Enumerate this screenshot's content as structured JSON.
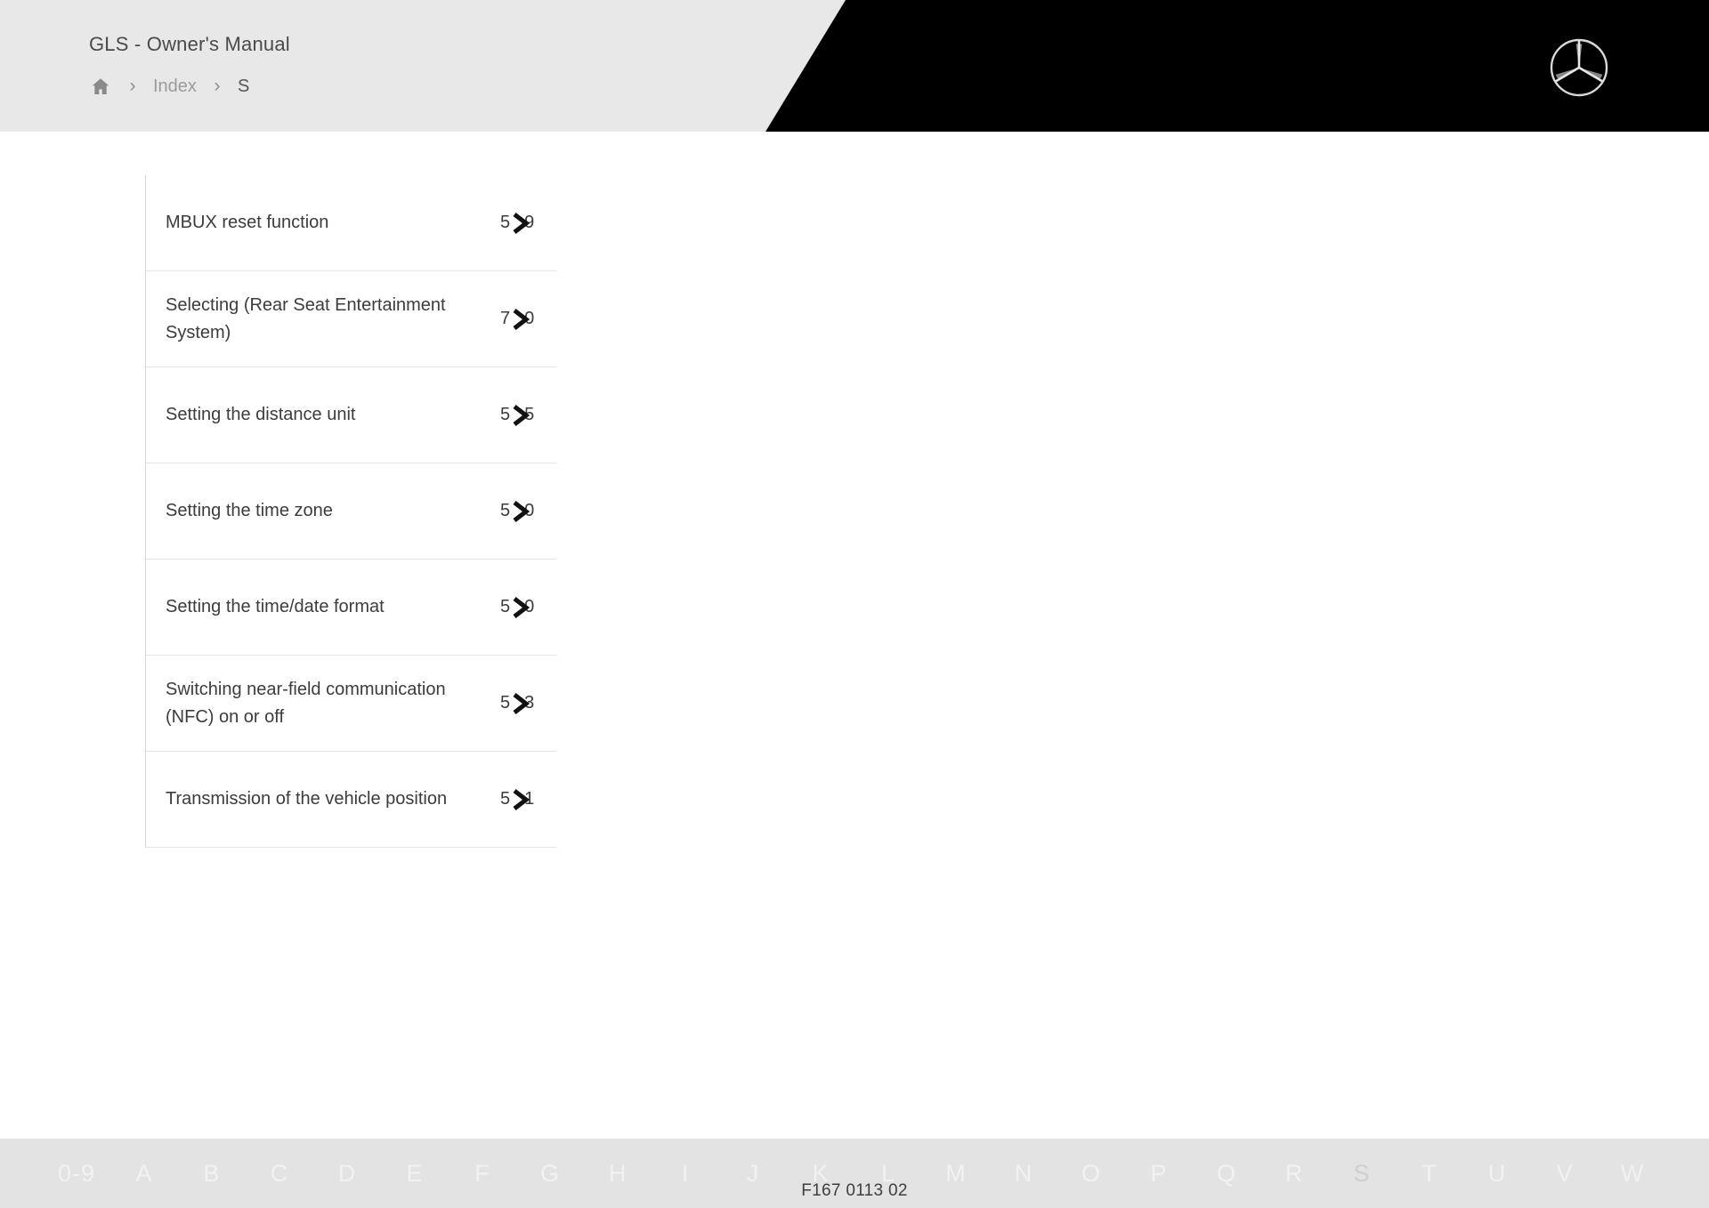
{
  "header": {
    "title": "GLS - Owner's Manual",
    "breadcrumb": {
      "home_icon": "home-icon",
      "separator": "›",
      "items": [
        {
          "label": "Index",
          "current": false
        },
        {
          "label": "S",
          "current": true
        }
      ]
    },
    "brand_logo": "mercedes-star-icon",
    "background_color": "#e8e8e8",
    "panel_color": "#000000"
  },
  "index_list": {
    "rows": [
      {
        "label": "MBUX reset function",
        "page": "59",
        "page_prefix": "5",
        "page_suffix": "9",
        "chevron": "chevron-right-icon"
      },
      {
        "label": "Selecting (Rear Seat Entertainment System)",
        "page": "70",
        "page_prefix": "7",
        "page_suffix": "0",
        "chevron": "chevron-right-icon"
      },
      {
        "label": "Setting the distance unit",
        "page": "55",
        "page_prefix": "5",
        "page_suffix": "5",
        "chevron": "chevron-right-icon"
      },
      {
        "label": "Setting the time zone",
        "page": "50",
        "page_prefix": "5",
        "page_suffix": "0",
        "chevron": "chevron-right-icon"
      },
      {
        "label": "Setting the time/date format",
        "page": "50",
        "page_prefix": "5",
        "page_suffix": "0",
        "chevron": "chevron-right-icon"
      },
      {
        "label": "Switching near-field communication (NFC) on or off",
        "page": "53",
        "page_prefix": "5",
        "page_suffix": "3",
        "chevron": "chevron-right-icon"
      },
      {
        "label": "Transmission of the vehicle position",
        "page": "51",
        "page_prefix": "5",
        "page_suffix": "1",
        "chevron": "chevron-right-icon"
      }
    ]
  },
  "footer": {
    "alphabet": [
      {
        "label": "0-9",
        "active": false
      },
      {
        "label": "A",
        "active": false
      },
      {
        "label": "B",
        "active": false
      },
      {
        "label": "C",
        "active": false
      },
      {
        "label": "D",
        "active": false
      },
      {
        "label": "E",
        "active": false
      },
      {
        "label": "F",
        "active": false
      },
      {
        "label": "G",
        "active": false
      },
      {
        "label": "H",
        "active": false
      },
      {
        "label": "I",
        "active": false
      },
      {
        "label": "J",
        "active": false
      },
      {
        "label": "K",
        "active": false
      },
      {
        "label": "L",
        "active": false
      },
      {
        "label": "M",
        "active": false
      },
      {
        "label": "N",
        "active": false
      },
      {
        "label": "O",
        "active": false
      },
      {
        "label": "P",
        "active": false
      },
      {
        "label": "Q",
        "active": false
      },
      {
        "label": "R",
        "active": false
      },
      {
        "label": "S",
        "active": true
      },
      {
        "label": "T",
        "active": false
      },
      {
        "label": "U",
        "active": false
      },
      {
        "label": "V",
        "active": false
      },
      {
        "label": "W",
        "active": false
      }
    ],
    "document_code": "F167 0113 02",
    "background_color": "#e3e3e3"
  }
}
